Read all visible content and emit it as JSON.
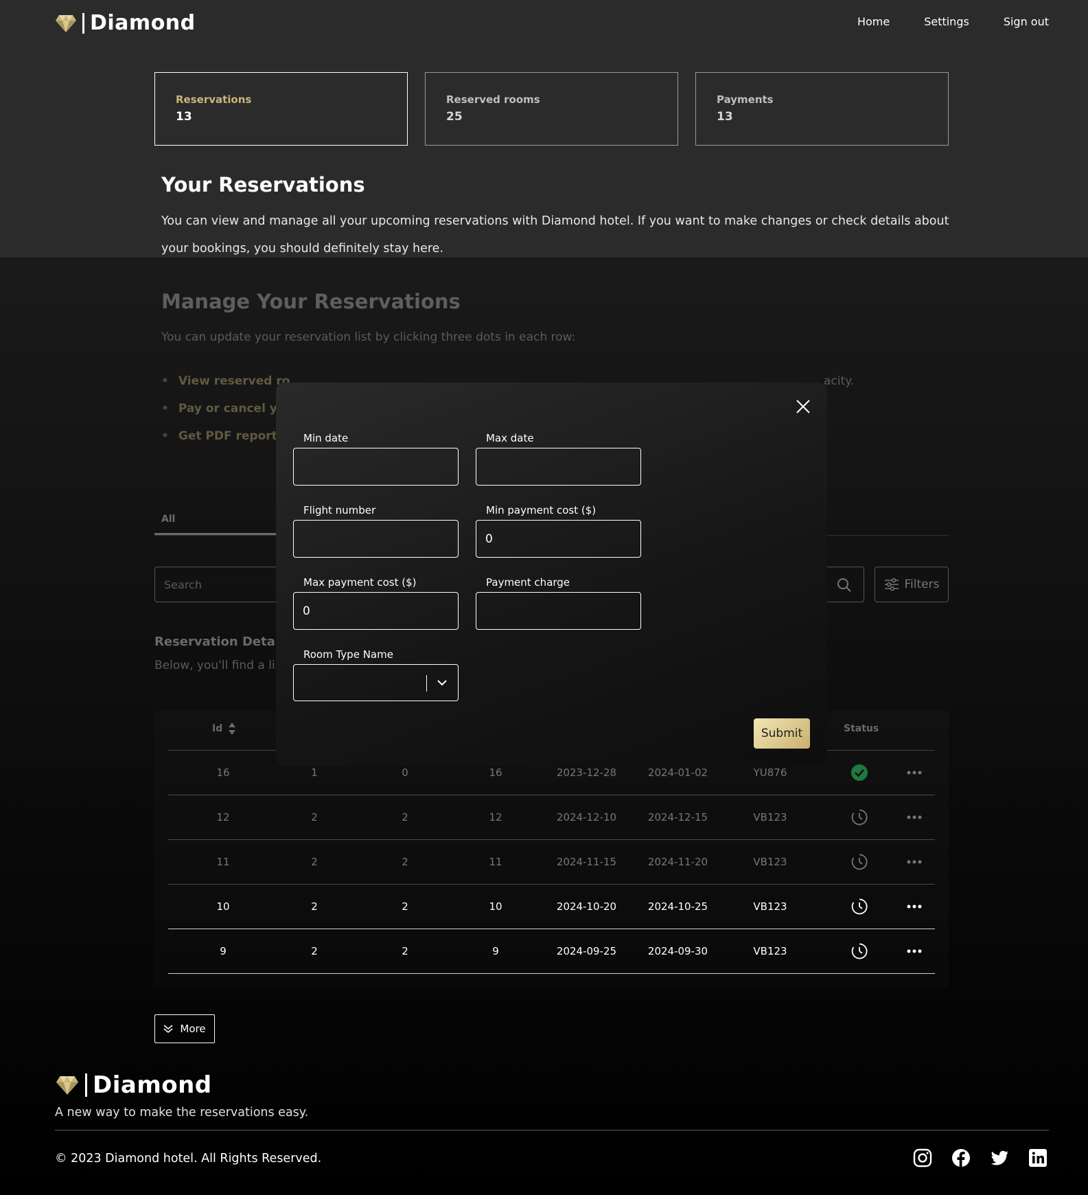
{
  "header": {
    "brand": "Diamond",
    "nav": [
      "Home",
      "Settings",
      "Sign out"
    ]
  },
  "stats": [
    {
      "label": "Reservations",
      "value": "13"
    },
    {
      "label": "Reserved rooms",
      "value": "25"
    },
    {
      "label": "Payments",
      "value": "13"
    }
  ],
  "intro": {
    "title": "Your Reservations",
    "line1": "You can view and manage all your upcoming reservations with Diamond hotel. If you want to make changes or check details about",
    "line2": "your bookings, you should definitely stay here."
  },
  "manage": {
    "title": "Manage Your Reservations",
    "subtitle": "You can update your reservation list by clicking three dots in each row:",
    "bullet1_visible": "View reserved ro",
    "bullet1_tail": "acity.",
    "bullet2_visible": "Pay or cancel yo",
    "bullet3_visible": "Get PDF report: D"
  },
  "tabs": {
    "all": "All"
  },
  "search": {
    "placeholder": "Search",
    "filters": "Filters"
  },
  "details": {
    "title": "Reservation Details",
    "subtitle_visible": "Below, you'll find a lis"
  },
  "table": {
    "headers": {
      "id": "Id",
      "status": "Status"
    },
    "rows": [
      {
        "id": "16",
        "c2": "1",
        "c3": "0",
        "c4": "16",
        "start": "2023-12-28",
        "end": "2024-01-02",
        "flight": "YU876",
        "status": "confirmed"
      },
      {
        "id": "12",
        "c2": "2",
        "c3": "2",
        "c4": "12",
        "start": "2024-12-10",
        "end": "2024-12-15",
        "flight": "VB123",
        "status": "pending"
      },
      {
        "id": "11",
        "c2": "2",
        "c3": "2",
        "c4": "11",
        "start": "2024-11-15",
        "end": "2024-11-20",
        "flight": "VB123",
        "status": "pending"
      },
      {
        "id": "10",
        "c2": "2",
        "c3": "2",
        "c4": "10",
        "start": "2024-10-20",
        "end": "2024-10-25",
        "flight": "VB123",
        "status": "pending"
      },
      {
        "id": "9",
        "c2": "2",
        "c3": "2",
        "c4": "9",
        "start": "2024-09-25",
        "end": "2024-09-30",
        "flight": "VB123",
        "status": "pending"
      }
    ]
  },
  "more_button": "More",
  "modal": {
    "min_date_label": "Min date",
    "min_date_value": "",
    "max_date_label": "Max date",
    "max_date_value": "",
    "flight_label": "Flight number",
    "flight_value": "",
    "min_cost_label": "Min payment cost ($)",
    "min_cost_value": "0",
    "max_cost_label": "Max payment cost ($)",
    "max_cost_value": "0",
    "charge_label": "Payment charge",
    "charge_value": "",
    "room_type_label": "Room Type Name",
    "room_type_value": "",
    "submit": "Submit"
  },
  "footer": {
    "brand": "Diamond",
    "tagline": "A new way to make the reservations easy.",
    "copyright": "© 2023 Diamond hotel. All Rights Reserved.",
    "social_icons": [
      "instagram-icon",
      "facebook-icon",
      "twitter-icon",
      "linkedin-icon"
    ]
  },
  "colors": {
    "gold": "#c9b67c",
    "confirmed": "#27ae60"
  }
}
